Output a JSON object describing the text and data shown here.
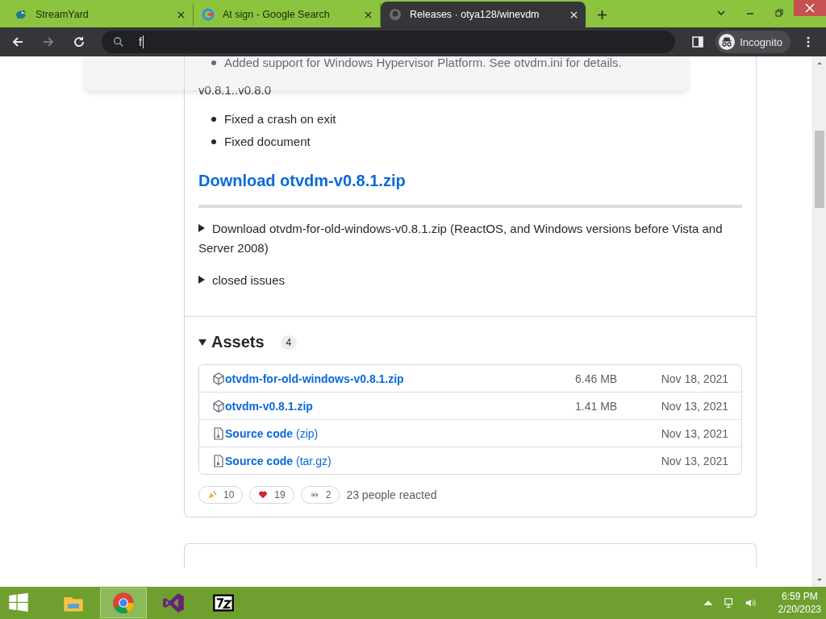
{
  "tabs": [
    {
      "title": "StreamYard",
      "selected": false
    },
    {
      "title": "At sign - Google Search",
      "selected": false
    },
    {
      "title": "Releases · otya128/winevdm",
      "selected": true
    }
  ],
  "address_bar": {
    "value": "f"
  },
  "profile": {
    "label": "Incognito"
  },
  "release": {
    "top_bullets": [
      "Added support for Windows Hypervisor Platform. See otvdm.ini for details."
    ],
    "range": "v0.8.1..v0.8.0",
    "bullets": [
      "Fixed a crash on exit",
      "Fixed document"
    ],
    "download_link": "Download otvdm-v0.8.1.zip",
    "details": [
      {
        "summary": "Download otvdm-for-old-windows-v0.8.1.zip (ReactOS, and Windows versions before Vista and Server 2008)",
        "expanded": false
      },
      {
        "summary": "closed issues",
        "expanded": false
      }
    ]
  },
  "assets": {
    "title": "Assets",
    "count": "4",
    "expanded": true,
    "items": [
      {
        "kind": "package",
        "name": "otvdm-for-old-windows-v0.8.1.zip",
        "size": "6.46 MB",
        "date": "Nov 18, 2021"
      },
      {
        "kind": "package",
        "name": "otvdm-v0.8.1.zip",
        "size": "1.41 MB",
        "date": "Nov 13, 2021"
      },
      {
        "kind": "source",
        "name": "Source code",
        "format": "(zip)",
        "date": "Nov 13, 2021"
      },
      {
        "kind": "source",
        "name": "Source code",
        "format": "(tar.gz)",
        "date": "Nov 13, 2021"
      }
    ]
  },
  "reactions": [
    {
      "count": "10"
    },
    {
      "count": "19"
    },
    {
      "count": "2"
    }
  ],
  "reaction_summary": "23 people reacted",
  "taskbar": {
    "time": "6:59 PM",
    "date": "2/20/2023"
  }
}
